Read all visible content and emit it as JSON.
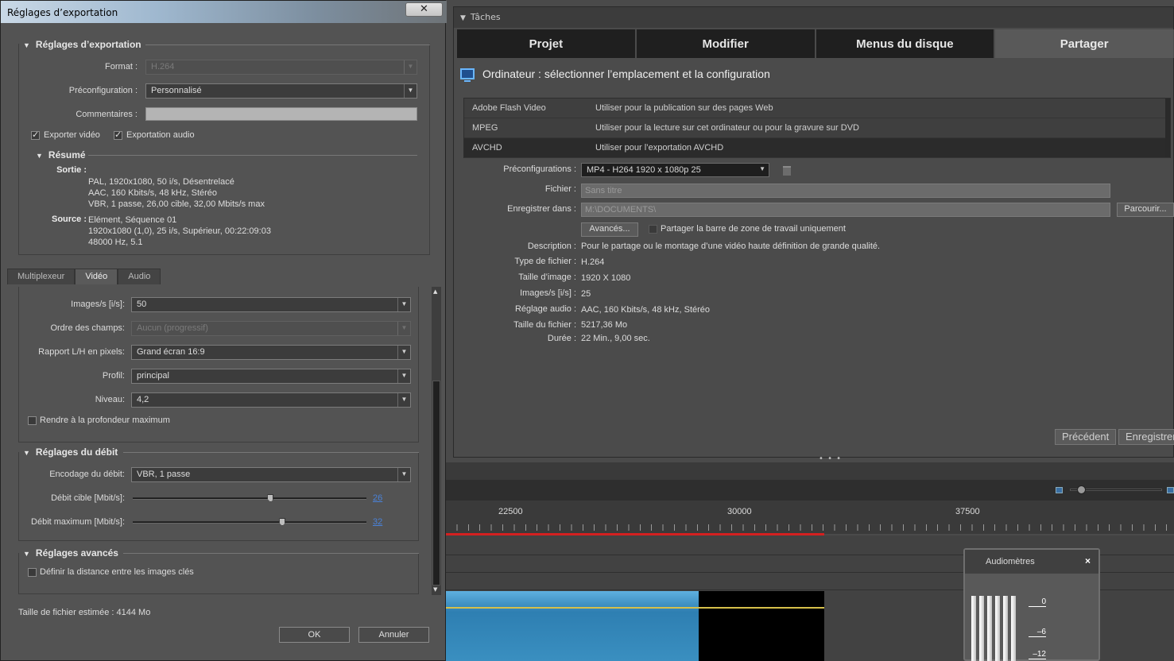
{
  "tasks": {
    "header": "Tâches",
    "tabs": [
      "Projet",
      "Modifier",
      "Menus du disque",
      "Partager"
    ],
    "share_title": "Ordinateur : sélectionner l’emplacement et la configuration",
    "destinations": [
      {
        "name": "Adobe Flash Video",
        "desc": "Utiliser pour la publication sur des pages Web"
      },
      {
        "name": "MPEG",
        "desc": "Utiliser pour la lecture sur cet ordinateur ou pour la gravure sur DVD"
      },
      {
        "name": "AVCHD",
        "desc": "Utiliser pour l’exportation AVCHD"
      }
    ],
    "presets_label": "Préconfigurations :",
    "presets_value": "MP4 - H264 1920 x 1080p 25",
    "file_label": "Fichier :",
    "file_placeholder": "Sans titre",
    "save_in_label": "Enregistrer dans :",
    "save_in_value": "M:\\DOCUMENTS\\",
    "browse_label": "Parcourir...",
    "advanced_label": "Avancés...",
    "share_workarea_label": "Partager la barre de zone de travail uniquement",
    "info": [
      {
        "label": "Description :",
        "value": "Pour le partage ou le montage d’une vidéo haute définition de grande qualité."
      },
      {
        "label": "Type de fichier :",
        "value": "H.264"
      },
      {
        "label": "Taille d’image :",
        "value": "1920 X 1080"
      },
      {
        "label": "Images/s [i/s] :",
        "value": "25"
      },
      {
        "label": "Réglage audio :",
        "value": "AAC, 160 Kbits/s, 48 kHz, Stéréo"
      },
      {
        "label": "Taille du fichier :",
        "value": "5217,36 Mo"
      },
      {
        "label": "Durée :",
        "value": "22 Min., 9,00 sec."
      }
    ],
    "prev_label": "Précédent",
    "save_label": "Enregistrer"
  },
  "timeline": {
    "grip": "• • •",
    "ruler": [
      "22500",
      "30000",
      "37500"
    ]
  },
  "audiometer": {
    "title": "Audiomètres",
    "close": "×",
    "ticks": [
      "0",
      "–6",
      "–12"
    ]
  },
  "dialog": {
    "title": "Réglages d’exportation",
    "close": "✕",
    "export_settings": {
      "header": "Réglages d’exportation",
      "format_label": "Format :",
      "format_value": "H.264",
      "preset_label": "Préconfiguration :",
      "preset_value": "Personnalisé",
      "comments_label": "Commentaires :",
      "export_video": "Exporter vidéo",
      "export_audio": "Exportation audio"
    },
    "summary": {
      "header": "Résumé",
      "output_key": "Sortie :",
      "output_lines": [
        "PAL, 1920x1080, 50 i/s, Désentrelacé",
        "AAC, 160 Kbits/s, 48 kHz, Stéréo",
        "VBR, 1 passe, 26,00 cible, 32,00 Mbits/s max"
      ],
      "source_key": "Source :",
      "source_lines": [
        "Elément, Séquence 01",
        "1920x1080 (1,0), 25 i/s, Supérieur, 00:22:09:03",
        "48000 Hz, 5.1"
      ]
    },
    "tabs": [
      "Multiplexeur",
      "Vidéo",
      "Audio"
    ],
    "video": {
      "fps_label": "Images/s [i/s]:",
      "fps_value": "50",
      "field_order_label": "Ordre des champs:",
      "field_order_value": "Aucun (progressif)",
      "pixel_aspect_label": "Rapport L/H en pixels:",
      "pixel_aspect_value": "Grand écran 16:9",
      "profile_label": "Profil:",
      "profile_value": "principal",
      "level_label": "Niveau:",
      "level_value": "4,2",
      "max_depth_label": "Rendre à la profondeur maximum"
    },
    "bitrate": {
      "header": "Réglages du débit",
      "encoding_label": "Encodage du débit:",
      "encoding_value": "VBR, 1 passe",
      "target_label": "Débit cible [Mbit/s]:",
      "target_value": "26",
      "target_fraction": 0.59,
      "max_label": "Débit maximum [Mbit/s]:",
      "max_value": "32",
      "max_fraction": 0.64
    },
    "advanced": {
      "header": "Réglages avancés",
      "keyframe_label": "Définir la distance entre les images clés"
    },
    "estimated_size": "Taille de fichier estimée : 4144 Mo",
    "ok_label": "OK",
    "cancel_label": "Annuler"
  }
}
